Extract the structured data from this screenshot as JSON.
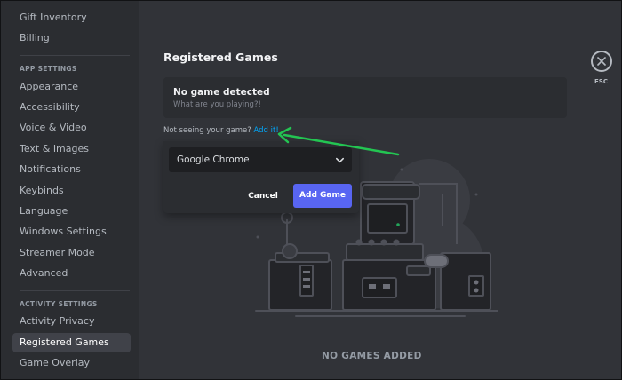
{
  "sidebar": {
    "items_top": [
      {
        "label": "Gift Inventory"
      },
      {
        "label": "Billing"
      }
    ],
    "app_settings_header": "APP SETTINGS",
    "app_settings": [
      {
        "label": "Appearance"
      },
      {
        "label": "Accessibility"
      },
      {
        "label": "Voice & Video"
      },
      {
        "label": "Text & Images"
      },
      {
        "label": "Notifications"
      },
      {
        "label": "Keybinds"
      },
      {
        "label": "Language"
      },
      {
        "label": "Windows Settings"
      },
      {
        "label": "Streamer Mode"
      },
      {
        "label": "Advanced"
      }
    ],
    "activity_settings_header": "ACTIVITY SETTINGS",
    "activity_settings": [
      {
        "label": "Activity Privacy"
      },
      {
        "label": "Registered Games"
      },
      {
        "label": "Game Overlay"
      }
    ],
    "active_item": "Registered Games"
  },
  "main": {
    "title": "Registered Games",
    "detect": {
      "title": "No game detected",
      "subtitle": "What are you playing?!"
    },
    "not_seeing_text": "Not seeing your game?",
    "add_link": "Add it!",
    "popup": {
      "selected_game": "Google Chrome",
      "cancel_label": "Cancel",
      "add_label": "Add Game"
    },
    "empty_state": "NO GAMES ADDED"
  },
  "close": {
    "esc_label": "ESC",
    "icon": "close-icon"
  },
  "colors": {
    "accent": "#5865f2",
    "link": "#00a8fc",
    "annotation_arrow": "#23c552",
    "background": "#313338",
    "sidebar": "#2b2d31"
  }
}
